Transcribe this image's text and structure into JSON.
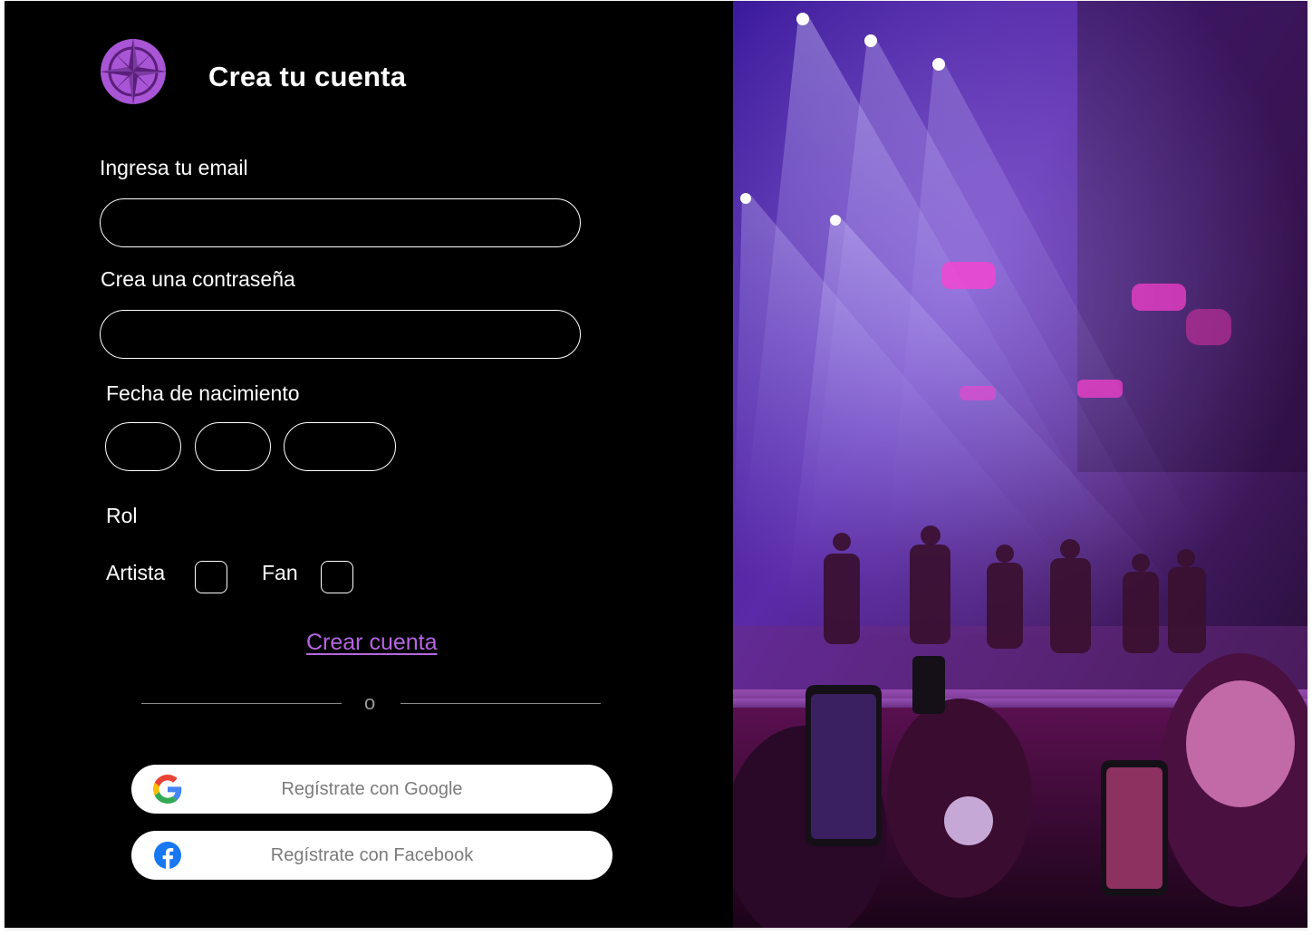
{
  "form": {
    "title": "Crea tu cuenta",
    "email_label": "Ingresa tu email",
    "email_value": "",
    "password_label": "Crea una contraseña",
    "password_value": "",
    "birthdate_label": "Fecha de nacimiento",
    "day_value": "",
    "month_value": "",
    "year_value": "",
    "role_label": "Rol",
    "role_options": [
      "Artista",
      "Fan"
    ],
    "submit_label": "Crear cuenta",
    "divider_text": "o",
    "google_label": "Regístrate con Google",
    "facebook_label": "Regístrate con Facebook"
  },
  "icons": {
    "logo": "compass-star-icon",
    "google": "google-icon",
    "facebook": "facebook-icon"
  },
  "colors": {
    "background": "#000000",
    "accent": "#b566e0",
    "logo_fill": "#a855d6",
    "facebook_blue": "#1877f2",
    "social_text": "#7b7b7b"
  }
}
